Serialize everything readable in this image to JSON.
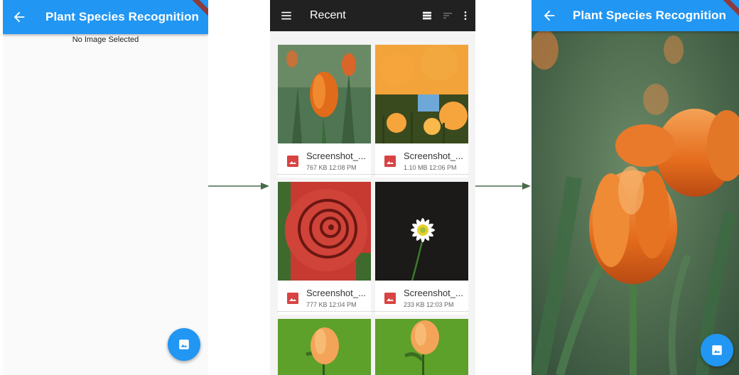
{
  "left_screen": {
    "title": "Plant Species Recognition",
    "status": "No Image Selected",
    "fab_icon": "image-icon"
  },
  "picker": {
    "title": "Recent",
    "icons": [
      "menu-icon",
      "list-view-icon",
      "sort-icon",
      "more-vert-icon"
    ],
    "files": [
      {
        "name": "Screenshot_...",
        "info": "767 KB 12:08 PM",
        "thumb": "orange-tulip"
      },
      {
        "name": "Screenshot_...",
        "info": "1.10 MB 12:06 PM",
        "thumb": "orange-daffodils"
      },
      {
        "name": "Screenshot_...",
        "info": "777 KB 12:04 PM",
        "thumb": "red-rose"
      },
      {
        "name": "Screenshot_...",
        "info": "233 KB 12:03 PM",
        "thumb": "white-daisy"
      },
      {
        "name": "",
        "info": "",
        "thumb": "orange-flower-green-1"
      },
      {
        "name": "",
        "info": "",
        "thumb": "orange-flower-green-2"
      }
    ]
  },
  "right_screen": {
    "title": "Plant Species Recognition",
    "fab_icon": "image-icon",
    "image": "orange-tulip-large"
  },
  "colors": {
    "primary": "#2196f3",
    "picker_bar": "#212121",
    "arrow": "#4a6b4a",
    "file_icon": "#d84343"
  }
}
